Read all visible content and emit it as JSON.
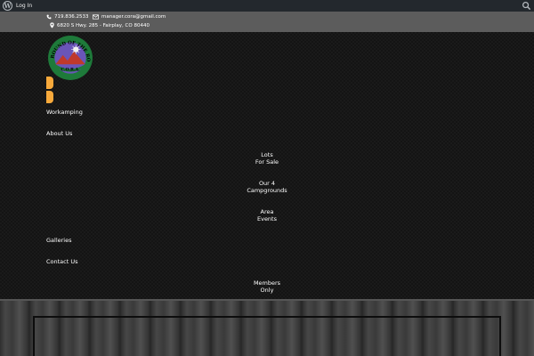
{
  "admin_bar": {
    "login_label": "Log In",
    "icons": [
      "wordpress-logo-icon",
      "search-icon"
    ]
  },
  "contact": {
    "phone": "719.836.2533",
    "email": "manager.cora@gmail.com",
    "address": "6820 S Hwy. 285 - Fairplay, CO 80440"
  },
  "logo": {
    "arc_text": "CAMPGROUND OF THE ROCKIES",
    "initials": "C.O.R.A."
  },
  "nav": {
    "workamping": "Workamping",
    "about_us": "About Us",
    "lots_line1": "Lots",
    "lots_line2": "For Sale",
    "campgrounds_line1": "Our 4",
    "campgrounds_line2": "Campgrounds",
    "events_line1": "Area",
    "events_line2": "Events",
    "galleries": "Galleries",
    "contact_us": "Contact Us",
    "members_line1": "Members",
    "members_line2": "Only"
  },
  "colors": {
    "accent": "#f7a93b",
    "admin_bar": "#23282d",
    "contact_bar": "#5c5c5c"
  }
}
